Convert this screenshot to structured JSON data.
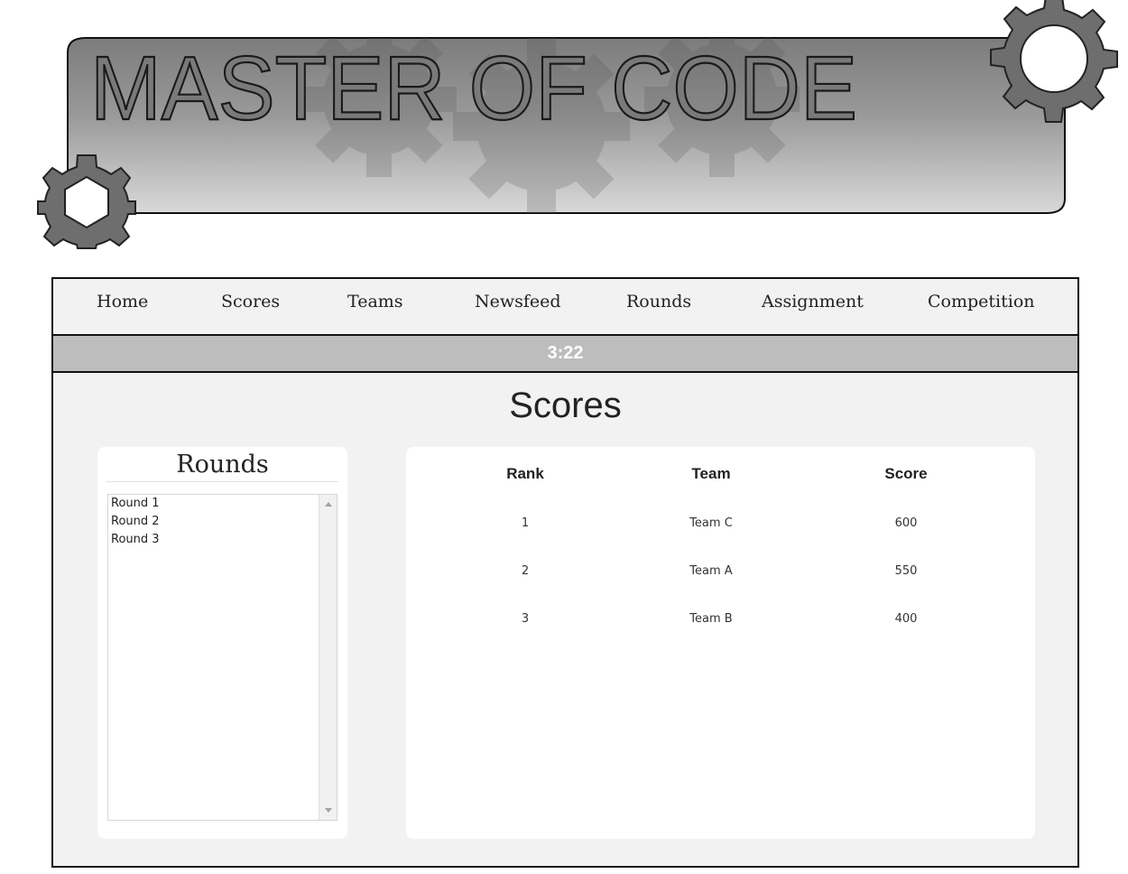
{
  "banner": {
    "title": "MASTER OF CODE"
  },
  "nav": {
    "items": [
      {
        "label": "Home"
      },
      {
        "label": "Scores"
      },
      {
        "label": "Teams"
      },
      {
        "label": "Newsfeed"
      },
      {
        "label": "Rounds"
      },
      {
        "label": "Assignment"
      },
      {
        "label": "Competition"
      }
    ]
  },
  "timer": {
    "value": "3:22"
  },
  "page": {
    "title": "Scores"
  },
  "rounds": {
    "heading": "Rounds",
    "items": [
      "Round 1",
      "Round 2",
      "Round 3"
    ]
  },
  "scores": {
    "headers": {
      "rank": "Rank",
      "team": "Team",
      "score": "Score"
    },
    "rows": [
      {
        "rank": "1",
        "team": "Team C",
        "score": "600"
      },
      {
        "rank": "2",
        "team": "Team A",
        "score": "550"
      },
      {
        "rank": "3",
        "team": "Team B",
        "score": "400"
      }
    ]
  },
  "colors": {
    "frame_border": "#111111",
    "nav_background": "#f2f2f2",
    "timer_bar": "#bdbdbd",
    "gear": "#6e6e6e"
  },
  "icons": {
    "top_right": "gear-icon",
    "bottom_left": "gear-icon",
    "scroll_up": "arrow-up-icon",
    "scroll_down": "arrow-down-icon"
  }
}
